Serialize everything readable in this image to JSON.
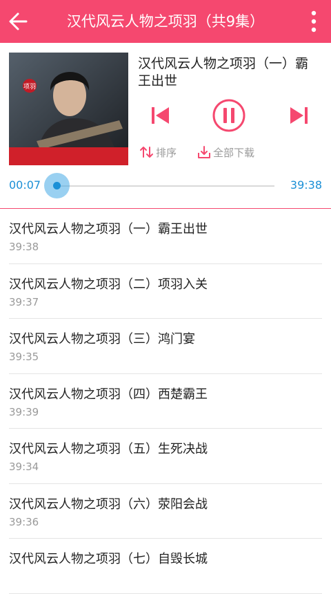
{
  "header": {
    "title": "汉代风云人物之项羽（共9集）"
  },
  "now_playing": {
    "title": "汉代风云人物之项羽（一）霸王出世",
    "current_time": "00:07",
    "total_time": "39:38",
    "cover_text": "项羽"
  },
  "tools": {
    "sort_label": "排序",
    "download_label": "全部下载"
  },
  "episodes": [
    {
      "title": "汉代风云人物之项羽（一）霸王出世",
      "duration": "39:38"
    },
    {
      "title": "汉代风云人物之项羽（二）项羽入关",
      "duration": "39:37"
    },
    {
      "title": "汉代风云人物之项羽（三）鸿门宴",
      "duration": "39:35"
    },
    {
      "title": "汉代风云人物之项羽（四）西楚霸王",
      "duration": "39:39"
    },
    {
      "title": "汉代风云人物之项羽（五）生死决战",
      "duration": "39:34"
    },
    {
      "title": "汉代风云人物之项羽（六）荥阳会战",
      "duration": "39:36"
    },
    {
      "title": "汉代风云人物之项羽（七）自毁长城",
      "duration": ""
    }
  ]
}
